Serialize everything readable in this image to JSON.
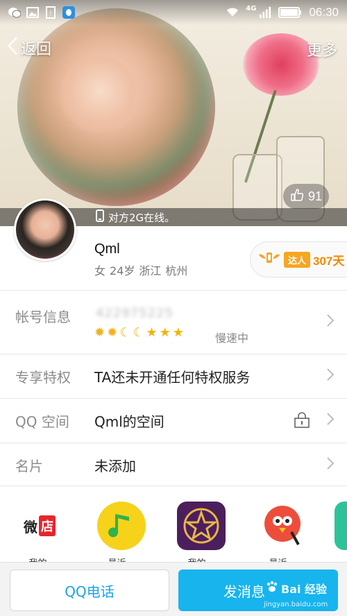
{
  "status_bar": {
    "left_icons": [
      "wechat-icon",
      "image-icon",
      "sim-icon",
      "qq-icon"
    ],
    "network": "4G",
    "time": "06:30"
  },
  "header": {
    "back_label": "返回",
    "more_label": "更多",
    "like_count": "91",
    "online_status": "对方2G在线。"
  },
  "profile": {
    "name": "Qml",
    "gender": "女",
    "age": "24岁",
    "province": "浙江",
    "city": "杭州",
    "badge_tag": "达人",
    "badge_days": "307天"
  },
  "info_rows": {
    "account": {
      "label": "帐号信息",
      "value": "422975225",
      "level_icons": [
        "sun",
        "sun",
        "moon",
        "moon",
        "star",
        "star",
        "star"
      ],
      "speed": "慢速中"
    },
    "privilege": {
      "label": "专享特权",
      "value": "TA还未开通任何特权服务"
    },
    "qzone": {
      "label": "QQ 空间",
      "value": "Qml的空间"
    },
    "card": {
      "label": "名片",
      "value": "未添加"
    }
  },
  "apps": [
    {
      "name": "weidian-app",
      "icon_text": "微店",
      "label": "我的…"
    },
    {
      "name": "qqmusic-app",
      "label": "最近…"
    },
    {
      "name": "star-app",
      "label": "我的…"
    },
    {
      "name": "sing-app",
      "label": "最近…"
    }
  ],
  "bottom_bar": {
    "call_label": "QQ电话",
    "message_label": "发消息",
    "watermark": "Bai 经验",
    "watermark_url": "jingyan.baidu.com"
  },
  "colors": {
    "accent_blue": "#18b4ed",
    "call_text": "#1aa3e8",
    "badge_orange": "#f5a623"
  }
}
